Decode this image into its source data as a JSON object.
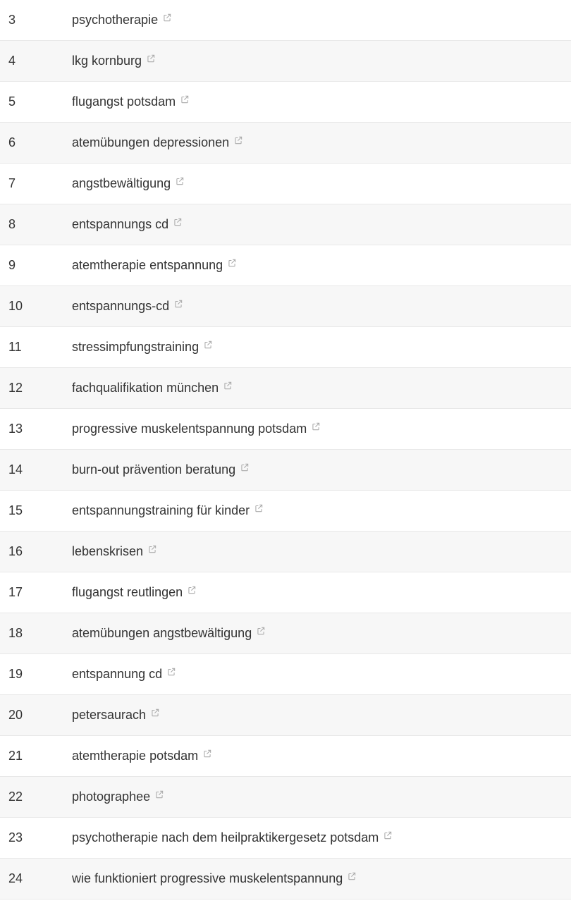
{
  "rows": [
    {
      "num": "3",
      "keyword": "psychotherapie"
    },
    {
      "num": "4",
      "keyword": "lkg kornburg"
    },
    {
      "num": "5",
      "keyword": "flugangst potsdam"
    },
    {
      "num": "6",
      "keyword": "atemübungen depressionen"
    },
    {
      "num": "7",
      "keyword": "angstbewältigung"
    },
    {
      "num": "8",
      "keyword": "entspannungs cd"
    },
    {
      "num": "9",
      "keyword": "atemtherapie entspannung"
    },
    {
      "num": "10",
      "keyword": "entspannungs-cd"
    },
    {
      "num": "11",
      "keyword": "stressimpfungstraining"
    },
    {
      "num": "12",
      "keyword": "fachqualifikation münchen"
    },
    {
      "num": "13",
      "keyword": "progressive muskelentspannung potsdam"
    },
    {
      "num": "14",
      "keyword": "burn-out prävention beratung"
    },
    {
      "num": "15",
      "keyword": "entspannungstraining für kinder"
    },
    {
      "num": "16",
      "keyword": "lebenskrisen"
    },
    {
      "num": "17",
      "keyword": "flugangst reutlingen"
    },
    {
      "num": "18",
      "keyword": "atemübungen angstbewältigung"
    },
    {
      "num": "19",
      "keyword": "entspannung cd"
    },
    {
      "num": "20",
      "keyword": "petersaurach"
    },
    {
      "num": "21",
      "keyword": "atemtherapie potsdam"
    },
    {
      "num": "22",
      "keyword": "photographee"
    },
    {
      "num": "23",
      "keyword": "psychotherapie nach dem heilpraktikergesetz potsdam"
    },
    {
      "num": "24",
      "keyword": "wie funktioniert progressive muskelentspannung"
    }
  ]
}
